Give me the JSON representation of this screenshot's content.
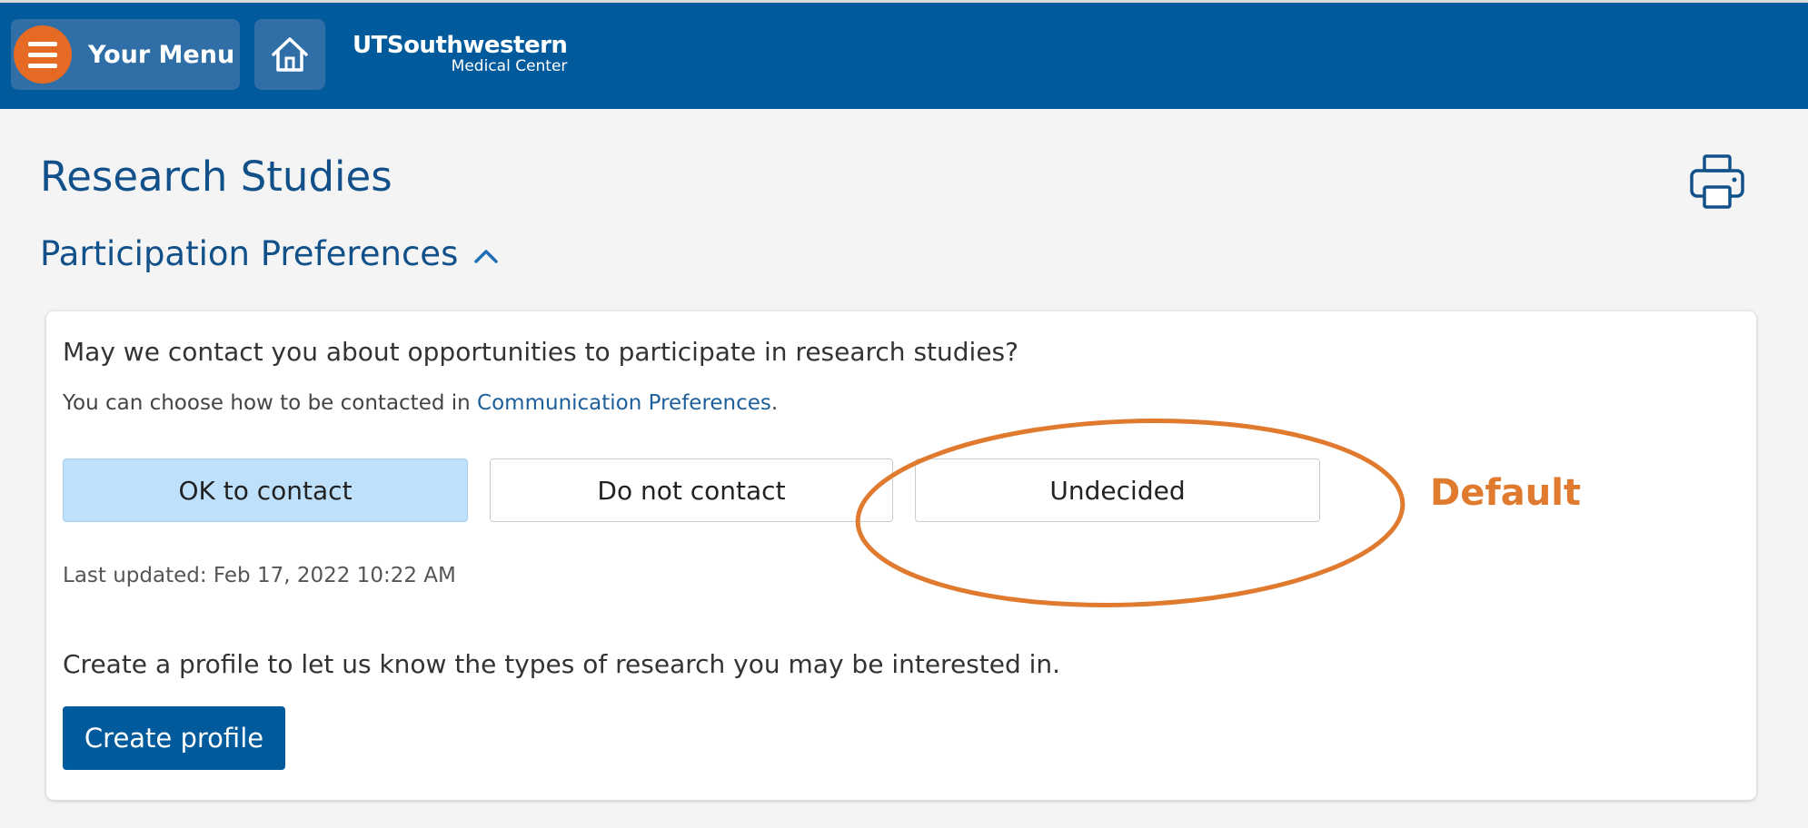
{
  "header": {
    "menu_label": "Your Menu",
    "logo_line1": "UTSouthwestern",
    "logo_line2": "Medical Center",
    "brand_color": "#005a9c",
    "menu_accent": "#e56b24"
  },
  "page": {
    "title": "Research Studies"
  },
  "section": {
    "title": "Participation Preferences",
    "expanded": true
  },
  "card": {
    "question": "May we contact you about opportunities to participate in research studies?",
    "hint_prefix": "You can choose how to be contacted in ",
    "hint_link": "Communication Preferences",
    "hint_suffix": ".",
    "options": [
      {
        "label": "OK to contact",
        "selected": true
      },
      {
        "label": "Do not contact",
        "selected": false
      },
      {
        "label": "Undecided",
        "selected": false
      }
    ],
    "last_updated": "Last updated: Feb 17, 2022 10:22 AM",
    "profile_text": "Create a profile to let us know the types of research you may be interested in.",
    "create_button": "Create profile"
  },
  "annotation": {
    "label": "Default",
    "color": "#e07a2e"
  },
  "icons": [
    "hamburger-icon",
    "home-icon",
    "printer-icon",
    "chevron-up-icon"
  ]
}
